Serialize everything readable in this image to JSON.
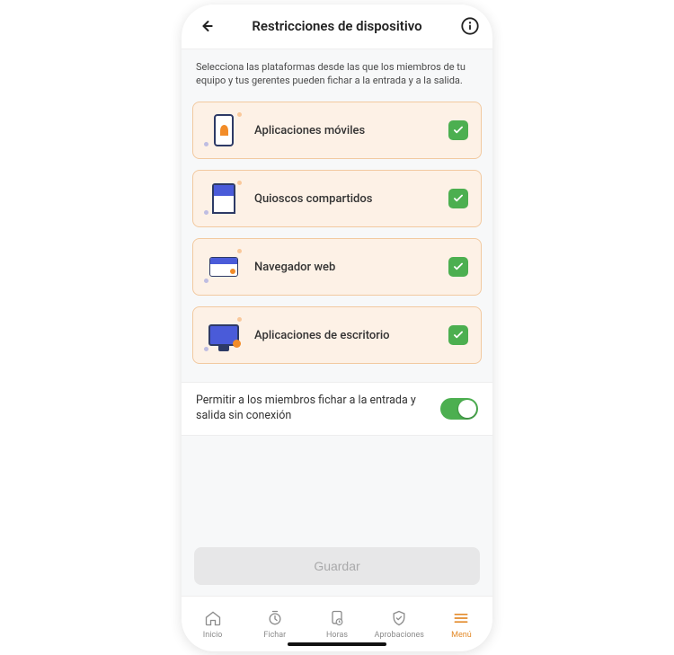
{
  "header": {
    "title": "Restricciones de dispositivo"
  },
  "description": "Selecciona las plataformas desde las que los miembros de tu equipo y tus gerentes pueden fichar a la entrada y a la salida.",
  "options": [
    {
      "label": "Aplicaciones móviles",
      "checked": true,
      "icon": "mobile-app-icon"
    },
    {
      "label": "Quioscos compartidos",
      "checked": true,
      "icon": "kiosk-icon"
    },
    {
      "label": "Navegador web",
      "checked": true,
      "icon": "web-browser-icon"
    },
    {
      "label": "Aplicaciones de escritorio",
      "checked": true,
      "icon": "desktop-app-icon"
    }
  ],
  "offline_toggle": {
    "label": "Permitir a los miembros fichar a la entrada y salida sin conexión",
    "enabled": true
  },
  "save_button": {
    "label": "Guardar",
    "enabled": false
  },
  "nav": {
    "items": [
      {
        "label": "Inicio",
        "icon": "home-icon",
        "active": false
      },
      {
        "label": "Fichar",
        "icon": "clock-icon",
        "active": false
      },
      {
        "label": "Horas",
        "icon": "hours-icon",
        "active": false
      },
      {
        "label": "Aprobaciones",
        "icon": "approvals-icon",
        "active": false
      },
      {
        "label": "Menú",
        "icon": "menu-icon",
        "active": true
      }
    ]
  },
  "colors": {
    "card_bg": "#fdf1e6",
    "card_border": "#f2c9a0",
    "check_green": "#4caf50",
    "accent_orange": "#e38b2b"
  }
}
